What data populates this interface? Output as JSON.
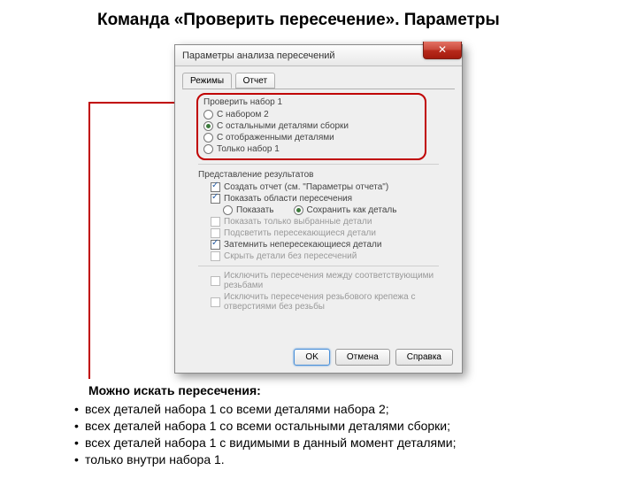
{
  "slide": {
    "title": "Команда «Проверить пересечение». Параметры"
  },
  "dialog": {
    "title": "Параметры анализа пересечений",
    "close": "✕",
    "tabs": {
      "modes": "Режимы",
      "report": "Отчет"
    },
    "set1": {
      "title": "Проверить набор 1",
      "opt_set2": "С набором 2",
      "opt_rest": "С остальными деталями сборки",
      "opt_displayed": "С отображенными деталями",
      "opt_only1": "Только набор 1"
    },
    "results": {
      "title": "Представление результатов",
      "create_report": "Создать отчет (см. \"Параметры отчета\")",
      "show_areas": "Показать области пересечения",
      "show": "Показать",
      "save_as_part": "Сохранить как деталь",
      "only_selected": "Показать только выбранные детали",
      "highlight": "Подсветить пересекающиеся детали",
      "dim": "Затемнить непересекающиеся детали",
      "hide_non": "Скрыть детали без пересечений"
    },
    "exclude": {
      "threads": "Исключить пересечения между соответствующими резьбами",
      "fasteners": "Исключить пересечения резьбового крепежа с отверстиями без резьбы"
    },
    "buttons": {
      "ok": "OK",
      "cancel": "Отмена",
      "help": "Справка"
    }
  },
  "notes": {
    "title": "Можно искать пересечения:",
    "b1": "всех деталей набора 1 со всеми деталями набора 2;",
    "b2": "всех деталей набора 1 со всеми остальными деталями сборки;",
    "b3": "всех деталей набора 1 с видимыми в данный момент деталями;",
    "b4": "только внутри набора 1."
  }
}
